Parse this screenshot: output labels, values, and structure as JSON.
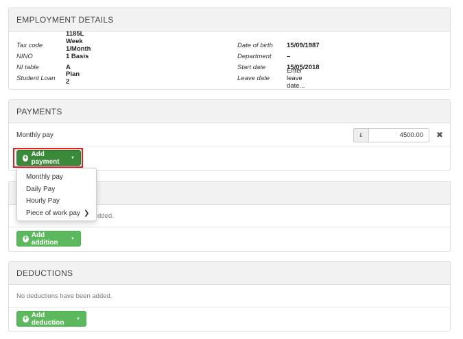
{
  "employment": {
    "title": "EMPLOYMENT DETAILS",
    "left": [
      {
        "label": "Tax code",
        "value": "1185L Week 1/Month 1 Basis"
      },
      {
        "label": "NINO",
        "value": ""
      },
      {
        "label": "NI table",
        "value": "A"
      },
      {
        "label": "Student Loan",
        "value": "Plan 2"
      }
    ],
    "right": [
      {
        "label": "Date of birth",
        "value": "15/09/1987"
      },
      {
        "label": "Department",
        "value": "–"
      },
      {
        "label": "Start date",
        "value": "15/05/2018"
      },
      {
        "label": "Leave date",
        "value": "Enter leave date..."
      }
    ]
  },
  "payments": {
    "title": "PAYMENTS",
    "row_label": "Monthly pay",
    "currency": "£",
    "amount": "4500.00",
    "add_button": "Add payment",
    "menu": [
      "Monthly pay",
      "Daily Pay",
      "Hourly Pay",
      "Piece of work pay"
    ]
  },
  "additions": {
    "empty_text": "dded.",
    "add_button": "Add addition"
  },
  "deductions": {
    "title": "DEDUCTIONS",
    "empty_text": "No deductions have been added.",
    "add_button": "Add deduction"
  },
  "colors": {
    "accent_green": "#5cb85c",
    "active_green": "#3a8a3a",
    "highlight_red": "#e0201f",
    "link_blue": "#337ab7"
  }
}
